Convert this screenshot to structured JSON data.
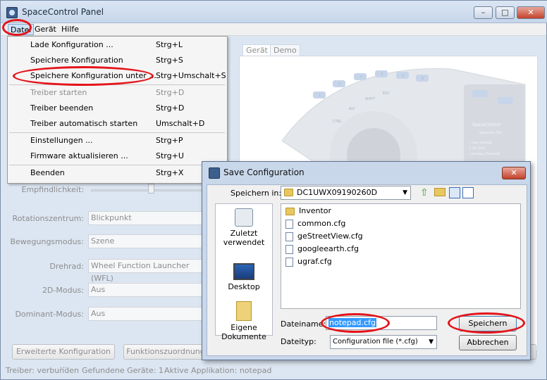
{
  "window": {
    "title": "SpaceControl Panel"
  },
  "menubar": [
    "Datei",
    "Gerät",
    "Hilfe"
  ],
  "file_menu": [
    {
      "label": "Lade Konfiguration ...",
      "shortcut": "Strg+L",
      "enabled": true
    },
    {
      "label": "Speichere Konfiguration",
      "shortcut": "Strg+S",
      "enabled": true
    },
    {
      "label": "Speichere Konfiguration unter ...",
      "shortcut": "Strg+Umschalt+S",
      "enabled": true
    },
    {
      "label": "Treiber starten",
      "shortcut": "Strg+D",
      "enabled": false
    },
    {
      "label": "Treiber beenden",
      "shortcut": "Strg+D",
      "enabled": true
    },
    {
      "label": "Treiber automatisch starten",
      "shortcut": "Umschalt+D",
      "enabled": true
    },
    {
      "label": "Einstellungen ...",
      "shortcut": "Strg+P",
      "enabled": true
    },
    {
      "label": "Firmware aktualisieren ...",
      "shortcut": "Strg+U",
      "enabled": true
    },
    {
      "label": "Beenden",
      "shortcut": "Strg+X",
      "enabled": true
    }
  ],
  "settings": {
    "sensitivity_label": "Empfindlichkeit:",
    "rotation_label": "Rotationszentrum:",
    "rotation_value": "Blickpunkt",
    "motion_label": "Bewegungsmodus:",
    "motion_value": "Szene",
    "wheel_label": "Drehrad:",
    "wheel_value": "Wheel Function Launcher (WFL)",
    "mode2d_label": "2D-Modus:",
    "mode2d_value": "Aus",
    "dominant_label": "Dominant-Modus:",
    "dominant_value": "Aus",
    "advanced_button": "Erweiterte Konfiguration ...",
    "function_button": "Funktionszuordnung"
  },
  "tabs": [
    "Gerät",
    "Demo"
  ],
  "device": {
    "brand": "SpaceControl",
    "screen_title": "Application Title",
    "screen_lines": [
      "1 Save_Settings",
      "2 Set_Zero",
      "3 Increase_Threshold"
    ],
    "keys": [
      "CTRL",
      "ALT",
      "SHIFT",
      "ESC"
    ],
    "numbers": [
      "1",
      "2",
      "3",
      "4",
      "5",
      "6"
    ]
  },
  "statusbar": {
    "driver": "Treiber: verbunden",
    "devices": "Gefundene Geräte: 1",
    "app": "Aktive Applikation: notepad"
  },
  "dialog": {
    "title": "Save Configuration",
    "save_in_label": "Speichern in:",
    "save_in_value": "DC1UWX09190260D",
    "places": [
      "Zuletzt verwendet",
      "Desktop",
      "Eigene Dokumente"
    ],
    "files": [
      {
        "name": "Inventor",
        "type": "folder"
      },
      {
        "name": "common.cfg",
        "type": "file"
      },
      {
        "name": "geStreetView.cfg",
        "type": "file"
      },
      {
        "name": "googleearth.cfg",
        "type": "file"
      },
      {
        "name": "ugraf.cfg",
        "type": "file"
      }
    ],
    "filename_label": "Dateiname:",
    "filename_value": "notepad.cfg",
    "filetype_label": "Dateityp:",
    "filetype_value": "Configuration file (*.cfg)",
    "save_button": "Speichern",
    "cancel_button": "Abbrechen"
  },
  "colors": {
    "highlight": "#e4141a",
    "selection": "#3399ff",
    "title_bg": "#c6d6eb"
  }
}
